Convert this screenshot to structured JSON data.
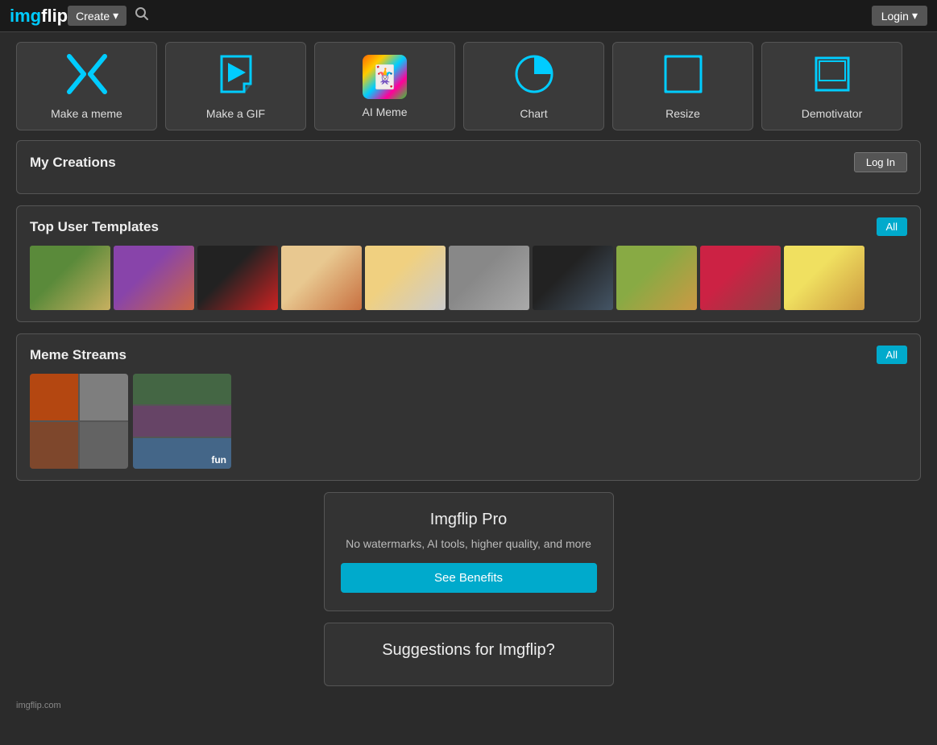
{
  "header": {
    "logo_text": "imgflip",
    "create_label": "Create",
    "login_label": "Login"
  },
  "tools": [
    {
      "id": "make-meme",
      "label": "Make a meme",
      "icon": "meme"
    },
    {
      "id": "make-gif",
      "label": "Make a GIF",
      "icon": "gif"
    },
    {
      "id": "ai-meme",
      "label": "AI Meme",
      "icon": "ai"
    },
    {
      "id": "chart",
      "label": "Chart",
      "icon": "chart"
    },
    {
      "id": "resize",
      "label": "Resize",
      "icon": "resize"
    },
    {
      "id": "demotivator",
      "label": "Demotivator",
      "icon": "demotivator"
    }
  ],
  "my_creations": {
    "title": "My Creations",
    "log_in_label": "Log In"
  },
  "top_templates": {
    "title": "Top User Templates",
    "all_label": "All",
    "items": [
      {
        "id": "t1",
        "class": "t1"
      },
      {
        "id": "t2",
        "class": "t2"
      },
      {
        "id": "t3",
        "class": "t3"
      },
      {
        "id": "t4",
        "class": "t4"
      },
      {
        "id": "t5",
        "class": "t5"
      },
      {
        "id": "t6",
        "class": "t6"
      },
      {
        "id": "t7",
        "class": "t7"
      },
      {
        "id": "t8",
        "class": "t8"
      },
      {
        "id": "t9",
        "class": "t9"
      },
      {
        "id": "t10",
        "class": "t10"
      }
    ]
  },
  "meme_streams": {
    "title": "Meme Streams",
    "all_label": "All",
    "items": [
      {
        "id": "s1",
        "label": "",
        "class": "s1"
      },
      {
        "id": "s2",
        "label": "fun",
        "class": "s2"
      }
    ]
  },
  "pro": {
    "title": "Imgflip Pro",
    "description": "No watermarks, AI tools, higher quality, and more",
    "cta_label": "See Benefits"
  },
  "suggestions": {
    "title": "Suggestions for Imgflip?"
  },
  "footer": {
    "text": "imgflip.com"
  }
}
